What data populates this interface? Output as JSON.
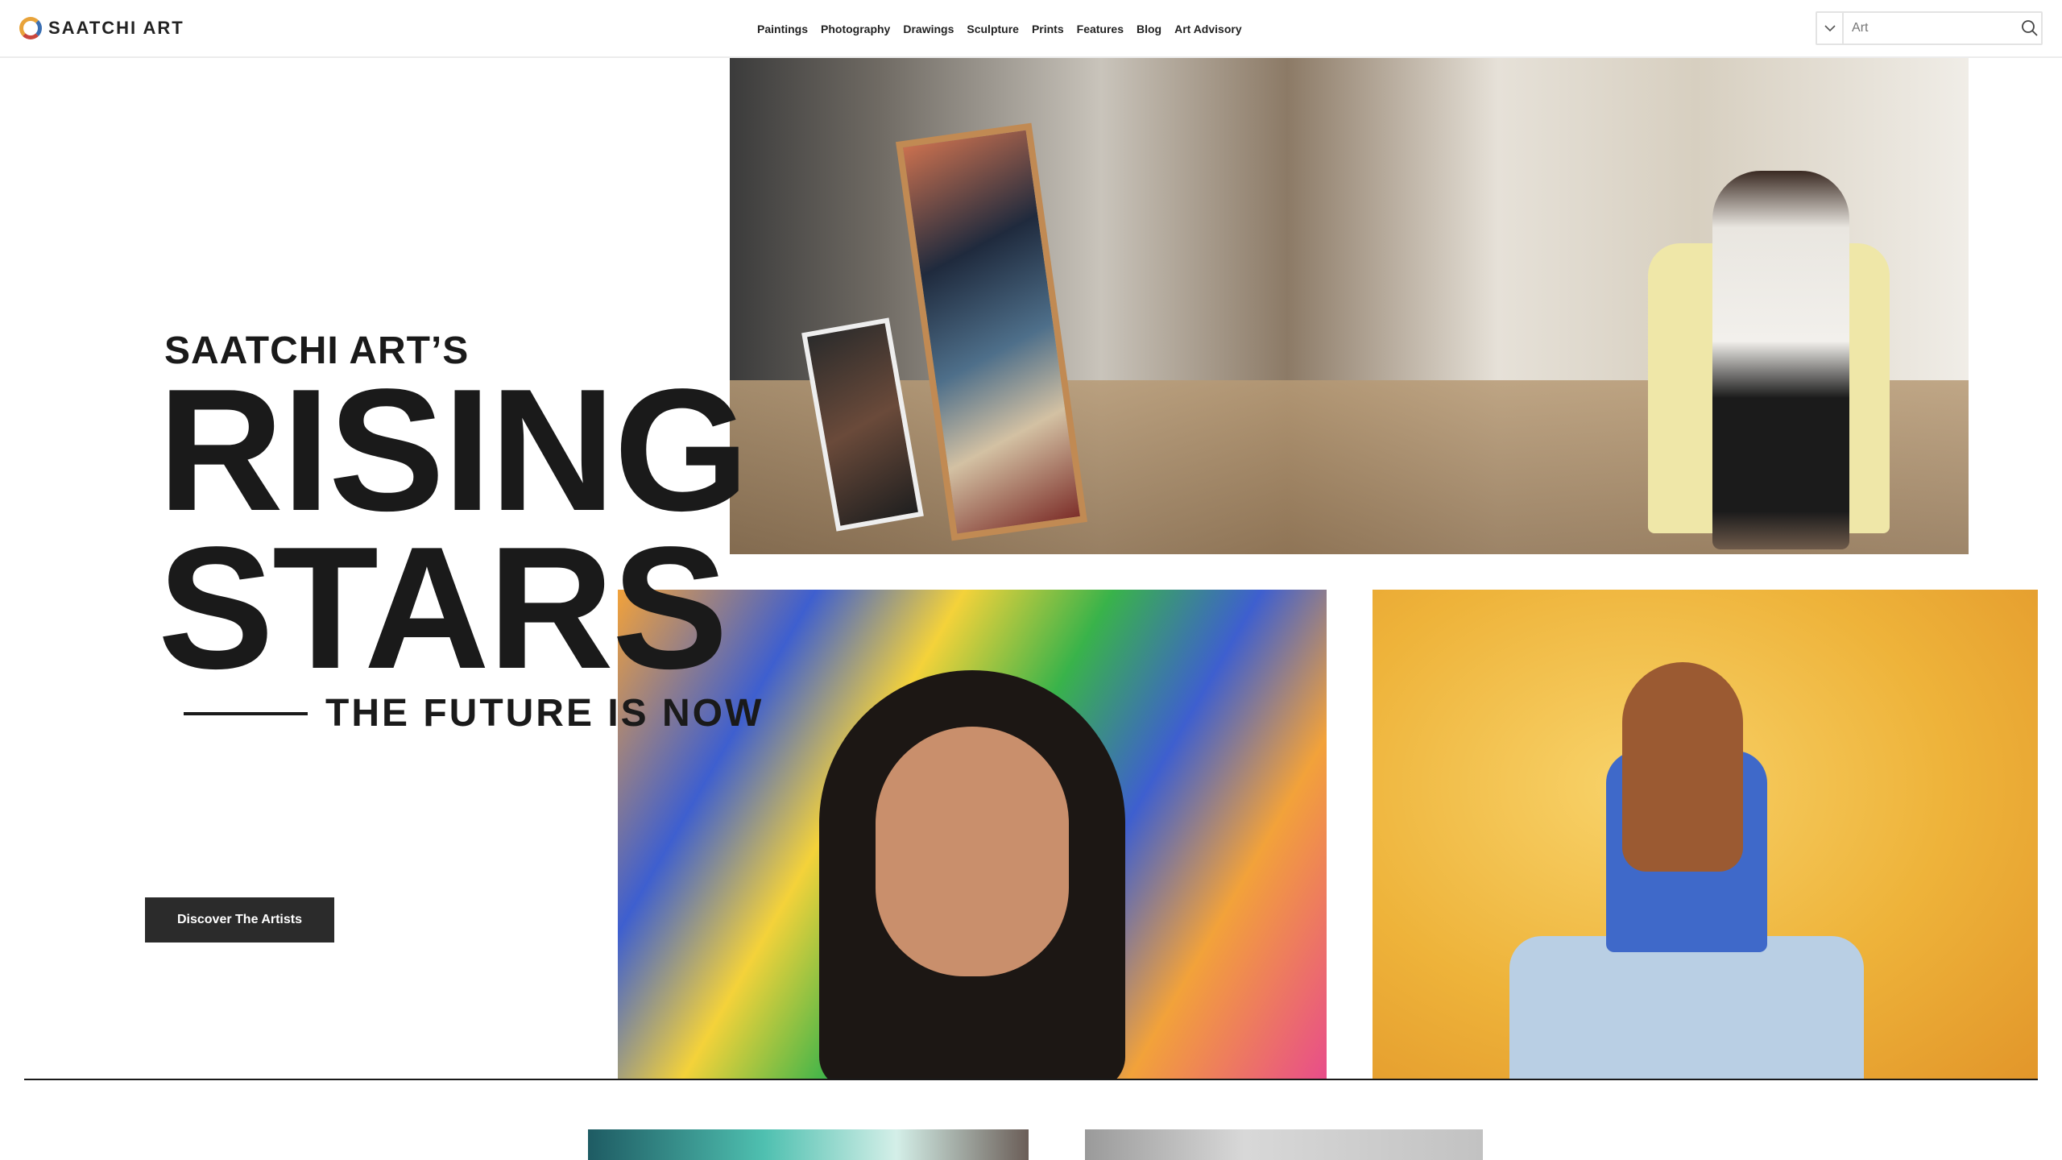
{
  "brand": {
    "name": "SAATCHI ART"
  },
  "nav": {
    "items": [
      "Paintings",
      "Photography",
      "Drawings",
      "Sculpture",
      "Prints",
      "Features",
      "Blog",
      "Art Advisory"
    ]
  },
  "search": {
    "placeholder": "Art",
    "value": ""
  },
  "hero": {
    "kicker": "SAATCHI ART’S",
    "headline_line1": "RISING",
    "headline_line2": "STARS",
    "tagline": "THE FUTURE IS NOW",
    "cta_label": "Discover The Artists"
  },
  "icons": {
    "logo": "saatchi-ring-logo",
    "dropdown": "chevron-down-icon",
    "search": "search-icon"
  },
  "colors": {
    "text": "#1a1a1a",
    "cta_bg": "#2b2b2b",
    "cta_text": "#ffffff"
  }
}
